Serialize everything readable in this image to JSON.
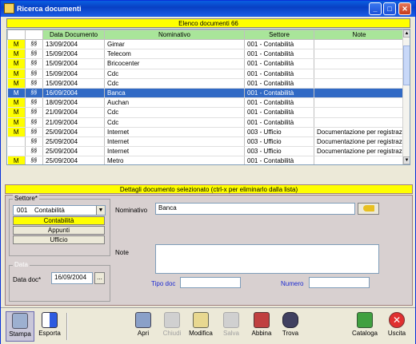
{
  "window": {
    "title": "Ricerca documenti"
  },
  "list": {
    "header": "Elenco documenti 66",
    "columns": [
      "",
      "",
      "Data Documento",
      "Nominativo",
      "Settore",
      "Note"
    ],
    "rows": [
      {
        "m": "M",
        "icon": "§§",
        "date": "13/09/2004",
        "name": "Gimar",
        "sector": "001 - Contabilità",
        "note": "",
        "selected": false
      },
      {
        "m": "M",
        "icon": "§§",
        "date": "15/09/2004",
        "name": "Telecom",
        "sector": "001 - Contabilità",
        "note": "",
        "selected": false
      },
      {
        "m": "M",
        "icon": "§§",
        "date": "15/09/2004",
        "name": "Bricocenter",
        "sector": "001 - Contabilità",
        "note": "",
        "selected": false
      },
      {
        "m": "M",
        "icon": "§§",
        "date": "15/09/2004",
        "name": "Cdc",
        "sector": "001 - Contabilità",
        "note": "",
        "selected": false
      },
      {
        "m": "M",
        "icon": "§§",
        "date": "15/09/2004",
        "name": "Cdc",
        "sector": "001 - Contabilità",
        "note": "",
        "selected": false
      },
      {
        "m": "M",
        "icon": "§§",
        "date": "16/09/2004",
        "name": "Banca",
        "sector": "001 - Contabilità",
        "note": "",
        "selected": true
      },
      {
        "m": "M",
        "icon": "§§",
        "date": "18/09/2004",
        "name": "Auchan",
        "sector": "001 - Contabilità",
        "note": "",
        "selected": false
      },
      {
        "m": "M",
        "icon": "§§",
        "date": "21/09/2004",
        "name": "Cdc",
        "sector": "001 - Contabilità",
        "note": "",
        "selected": false
      },
      {
        "m": "M",
        "icon": "§§",
        "date": "21/09/2004",
        "name": "Cdc",
        "sector": "001 - Contabilità",
        "note": "",
        "selected": false
      },
      {
        "m": "M",
        "icon": "§§",
        "date": "25/09/2004",
        "name": "Internet",
        "sector": "003 - Ufficio",
        "note": "Documentazione per registrazio",
        "selected": false
      },
      {
        "m": "",
        "icon": "§§",
        "date": "25/09/2004",
        "name": "Internet",
        "sector": "003 - Ufficio",
        "note": "Documentazione per registrazio",
        "selected": false
      },
      {
        "m": "",
        "icon": "§§",
        "date": "25/09/2004",
        "name": "Internet",
        "sector": "003 - Ufficio",
        "note": "Documentazione per registrazio",
        "selected": false
      },
      {
        "m": "M",
        "icon": "§§",
        "date": "25/09/2004",
        "name": "Metro",
        "sector": "001 - Contabilità",
        "note": "",
        "selected": false
      }
    ]
  },
  "details": {
    "header": "Dettagli documento selezionato (ctrl-x per eliminarlo dalla lista)",
    "settore_label": "Settore*",
    "settore_code": "001",
    "settore_value": "Contabilità",
    "sectors": [
      "Contabilità",
      "Appunti",
      "Ufficio"
    ],
    "data_group": "Data",
    "data_doc_label": "Data doc*",
    "data_doc_value": "16/09/2004",
    "date_btn": "...",
    "nominativo_label": "Nominativo",
    "nominativo_value": "Banca",
    "note_label": "Note",
    "note_value": "",
    "tipo_doc_label": "Tipo doc",
    "tipo_doc_value": "",
    "numero_label": "Numero",
    "numero_value": ""
  },
  "toolbar": {
    "stampa": "Stampa",
    "esporta": "Esporta",
    "apri": "Apri",
    "chiudi": "Chiudi",
    "modifica": "Modifica",
    "salva": "Salva",
    "abbina": "Abbina",
    "trova": "Trova",
    "cataloga": "Cataloga",
    "uscita": "Uscita"
  }
}
